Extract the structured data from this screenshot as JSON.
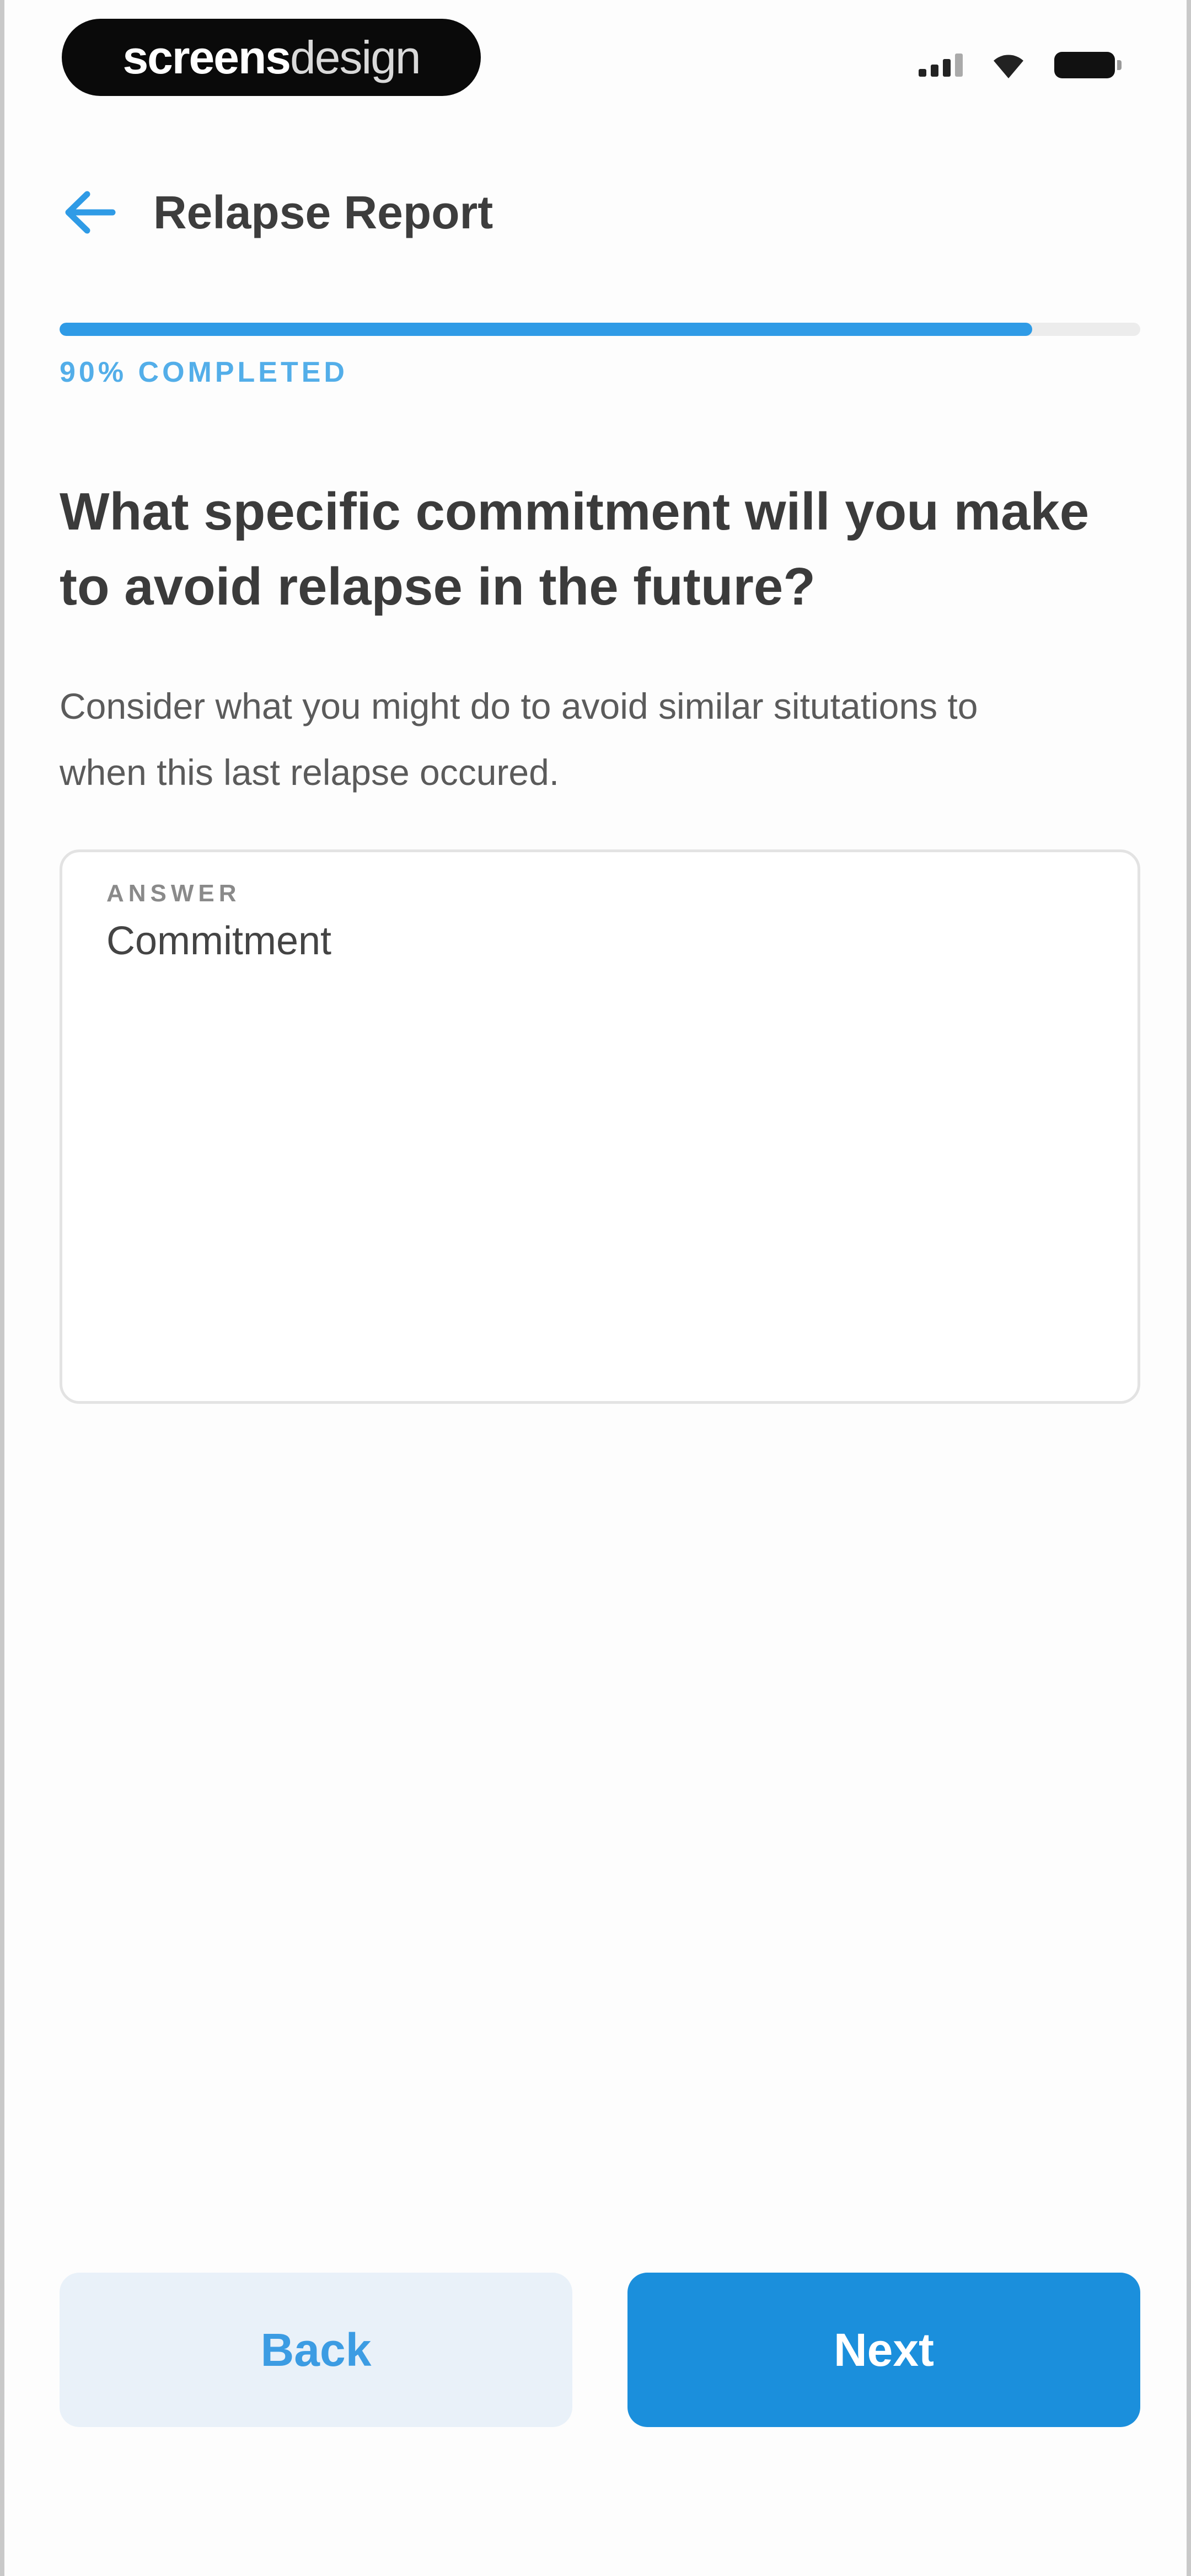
{
  "status_bar": {
    "brand_bold": "screens",
    "brand_light": "design"
  },
  "header": {
    "title": "Relapse Report"
  },
  "progress": {
    "fraction": 0.9,
    "label": "90% COMPLETED"
  },
  "question": {
    "title": "What specific commitment will you make to avoid relapse in the future?",
    "hint": "Consider what you might do to avoid similar situtations to when this last relapse occured."
  },
  "answer": {
    "label": "ANSWER",
    "value": "Commitment"
  },
  "footer": {
    "back_label": "Back",
    "next_label": "Next"
  },
  "colors": {
    "accent": "#1b8fdc",
    "progress": "#2f9be6",
    "back_button_bg": "#e9f1f9"
  }
}
